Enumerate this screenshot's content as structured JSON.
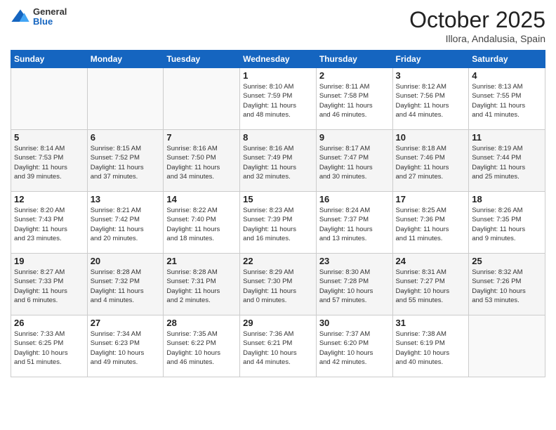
{
  "header": {
    "logo_general": "General",
    "logo_blue": "Blue",
    "month": "October 2025",
    "location": "Illora, Andalusia, Spain"
  },
  "weekdays": [
    "Sunday",
    "Monday",
    "Tuesday",
    "Wednesday",
    "Thursday",
    "Friday",
    "Saturday"
  ],
  "weeks": [
    [
      {
        "day": "",
        "info": ""
      },
      {
        "day": "",
        "info": ""
      },
      {
        "day": "",
        "info": ""
      },
      {
        "day": "1",
        "info": "Sunrise: 8:10 AM\nSunset: 7:59 PM\nDaylight: 11 hours\nand 48 minutes."
      },
      {
        "day": "2",
        "info": "Sunrise: 8:11 AM\nSunset: 7:58 PM\nDaylight: 11 hours\nand 46 minutes."
      },
      {
        "day": "3",
        "info": "Sunrise: 8:12 AM\nSunset: 7:56 PM\nDaylight: 11 hours\nand 44 minutes."
      },
      {
        "day": "4",
        "info": "Sunrise: 8:13 AM\nSunset: 7:55 PM\nDaylight: 11 hours\nand 41 minutes."
      }
    ],
    [
      {
        "day": "5",
        "info": "Sunrise: 8:14 AM\nSunset: 7:53 PM\nDaylight: 11 hours\nand 39 minutes."
      },
      {
        "day": "6",
        "info": "Sunrise: 8:15 AM\nSunset: 7:52 PM\nDaylight: 11 hours\nand 37 minutes."
      },
      {
        "day": "7",
        "info": "Sunrise: 8:16 AM\nSunset: 7:50 PM\nDaylight: 11 hours\nand 34 minutes."
      },
      {
        "day": "8",
        "info": "Sunrise: 8:16 AM\nSunset: 7:49 PM\nDaylight: 11 hours\nand 32 minutes."
      },
      {
        "day": "9",
        "info": "Sunrise: 8:17 AM\nSunset: 7:47 PM\nDaylight: 11 hours\nand 30 minutes."
      },
      {
        "day": "10",
        "info": "Sunrise: 8:18 AM\nSunset: 7:46 PM\nDaylight: 11 hours\nand 27 minutes."
      },
      {
        "day": "11",
        "info": "Sunrise: 8:19 AM\nSunset: 7:44 PM\nDaylight: 11 hours\nand 25 minutes."
      }
    ],
    [
      {
        "day": "12",
        "info": "Sunrise: 8:20 AM\nSunset: 7:43 PM\nDaylight: 11 hours\nand 23 minutes."
      },
      {
        "day": "13",
        "info": "Sunrise: 8:21 AM\nSunset: 7:42 PM\nDaylight: 11 hours\nand 20 minutes."
      },
      {
        "day": "14",
        "info": "Sunrise: 8:22 AM\nSunset: 7:40 PM\nDaylight: 11 hours\nand 18 minutes."
      },
      {
        "day": "15",
        "info": "Sunrise: 8:23 AM\nSunset: 7:39 PM\nDaylight: 11 hours\nand 16 minutes."
      },
      {
        "day": "16",
        "info": "Sunrise: 8:24 AM\nSunset: 7:37 PM\nDaylight: 11 hours\nand 13 minutes."
      },
      {
        "day": "17",
        "info": "Sunrise: 8:25 AM\nSunset: 7:36 PM\nDaylight: 11 hours\nand 11 minutes."
      },
      {
        "day": "18",
        "info": "Sunrise: 8:26 AM\nSunset: 7:35 PM\nDaylight: 11 hours\nand 9 minutes."
      }
    ],
    [
      {
        "day": "19",
        "info": "Sunrise: 8:27 AM\nSunset: 7:33 PM\nDaylight: 11 hours\nand 6 minutes."
      },
      {
        "day": "20",
        "info": "Sunrise: 8:28 AM\nSunset: 7:32 PM\nDaylight: 11 hours\nand 4 minutes."
      },
      {
        "day": "21",
        "info": "Sunrise: 8:28 AM\nSunset: 7:31 PM\nDaylight: 11 hours\nand 2 minutes."
      },
      {
        "day": "22",
        "info": "Sunrise: 8:29 AM\nSunset: 7:30 PM\nDaylight: 11 hours\nand 0 minutes."
      },
      {
        "day": "23",
        "info": "Sunrise: 8:30 AM\nSunset: 7:28 PM\nDaylight: 10 hours\nand 57 minutes."
      },
      {
        "day": "24",
        "info": "Sunrise: 8:31 AM\nSunset: 7:27 PM\nDaylight: 10 hours\nand 55 minutes."
      },
      {
        "day": "25",
        "info": "Sunrise: 8:32 AM\nSunset: 7:26 PM\nDaylight: 10 hours\nand 53 minutes."
      }
    ],
    [
      {
        "day": "26",
        "info": "Sunrise: 7:33 AM\nSunset: 6:25 PM\nDaylight: 10 hours\nand 51 minutes."
      },
      {
        "day": "27",
        "info": "Sunrise: 7:34 AM\nSunset: 6:23 PM\nDaylight: 10 hours\nand 49 minutes."
      },
      {
        "day": "28",
        "info": "Sunrise: 7:35 AM\nSunset: 6:22 PM\nDaylight: 10 hours\nand 46 minutes."
      },
      {
        "day": "29",
        "info": "Sunrise: 7:36 AM\nSunset: 6:21 PM\nDaylight: 10 hours\nand 44 minutes."
      },
      {
        "day": "30",
        "info": "Sunrise: 7:37 AM\nSunset: 6:20 PM\nDaylight: 10 hours\nand 42 minutes."
      },
      {
        "day": "31",
        "info": "Sunrise: 7:38 AM\nSunset: 6:19 PM\nDaylight: 10 hours\nand 40 minutes."
      },
      {
        "day": "",
        "info": ""
      }
    ]
  ]
}
